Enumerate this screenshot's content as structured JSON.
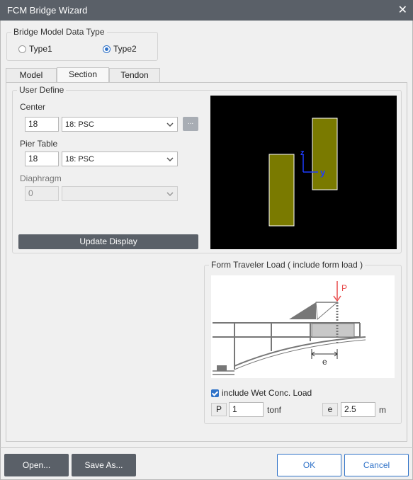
{
  "window": {
    "title": "FCM Bridge Wizard",
    "close_icon": "close-icon"
  },
  "model_type": {
    "legend": "Bridge Model Data Type",
    "options": [
      {
        "label": "Type1",
        "selected": false
      },
      {
        "label": "Type2",
        "selected": true
      }
    ]
  },
  "tabs": [
    {
      "label": "Model",
      "active": false
    },
    {
      "label": "Section",
      "active": true
    },
    {
      "label": "Tendon",
      "active": false
    }
  ],
  "user_define": {
    "legend": "User Define",
    "center": {
      "label": "Center",
      "id_value": "18",
      "section": "18: PSC",
      "browse_label": "..."
    },
    "pier_table": {
      "label": "Pier Table",
      "id_value": "18",
      "section": "18: PSC"
    },
    "diaphragm": {
      "label": "Diaphragm",
      "id_value": "0",
      "section": ""
    },
    "update_label": "Update Display"
  },
  "preview": {
    "axis_z": "z",
    "axis_y": "y",
    "fill_color": "#7a7a00",
    "axis_color": "#1e3cff"
  },
  "form_traveler": {
    "legend": "Form Traveler Load ( include form load )",
    "diagram_p": "P",
    "diagram_e": "e",
    "wet_conc_label": "include Wet Conc. Load",
    "wet_conc_checked": true,
    "p_tag": "P",
    "p_value": "1",
    "p_unit": "tonf",
    "e_tag": "e",
    "e_value": "2.5",
    "e_unit": "m"
  },
  "footer": {
    "open_label": "Open...",
    "save_as_label": "Save As...",
    "ok_label": "OK",
    "cancel_label": "Cancel"
  }
}
